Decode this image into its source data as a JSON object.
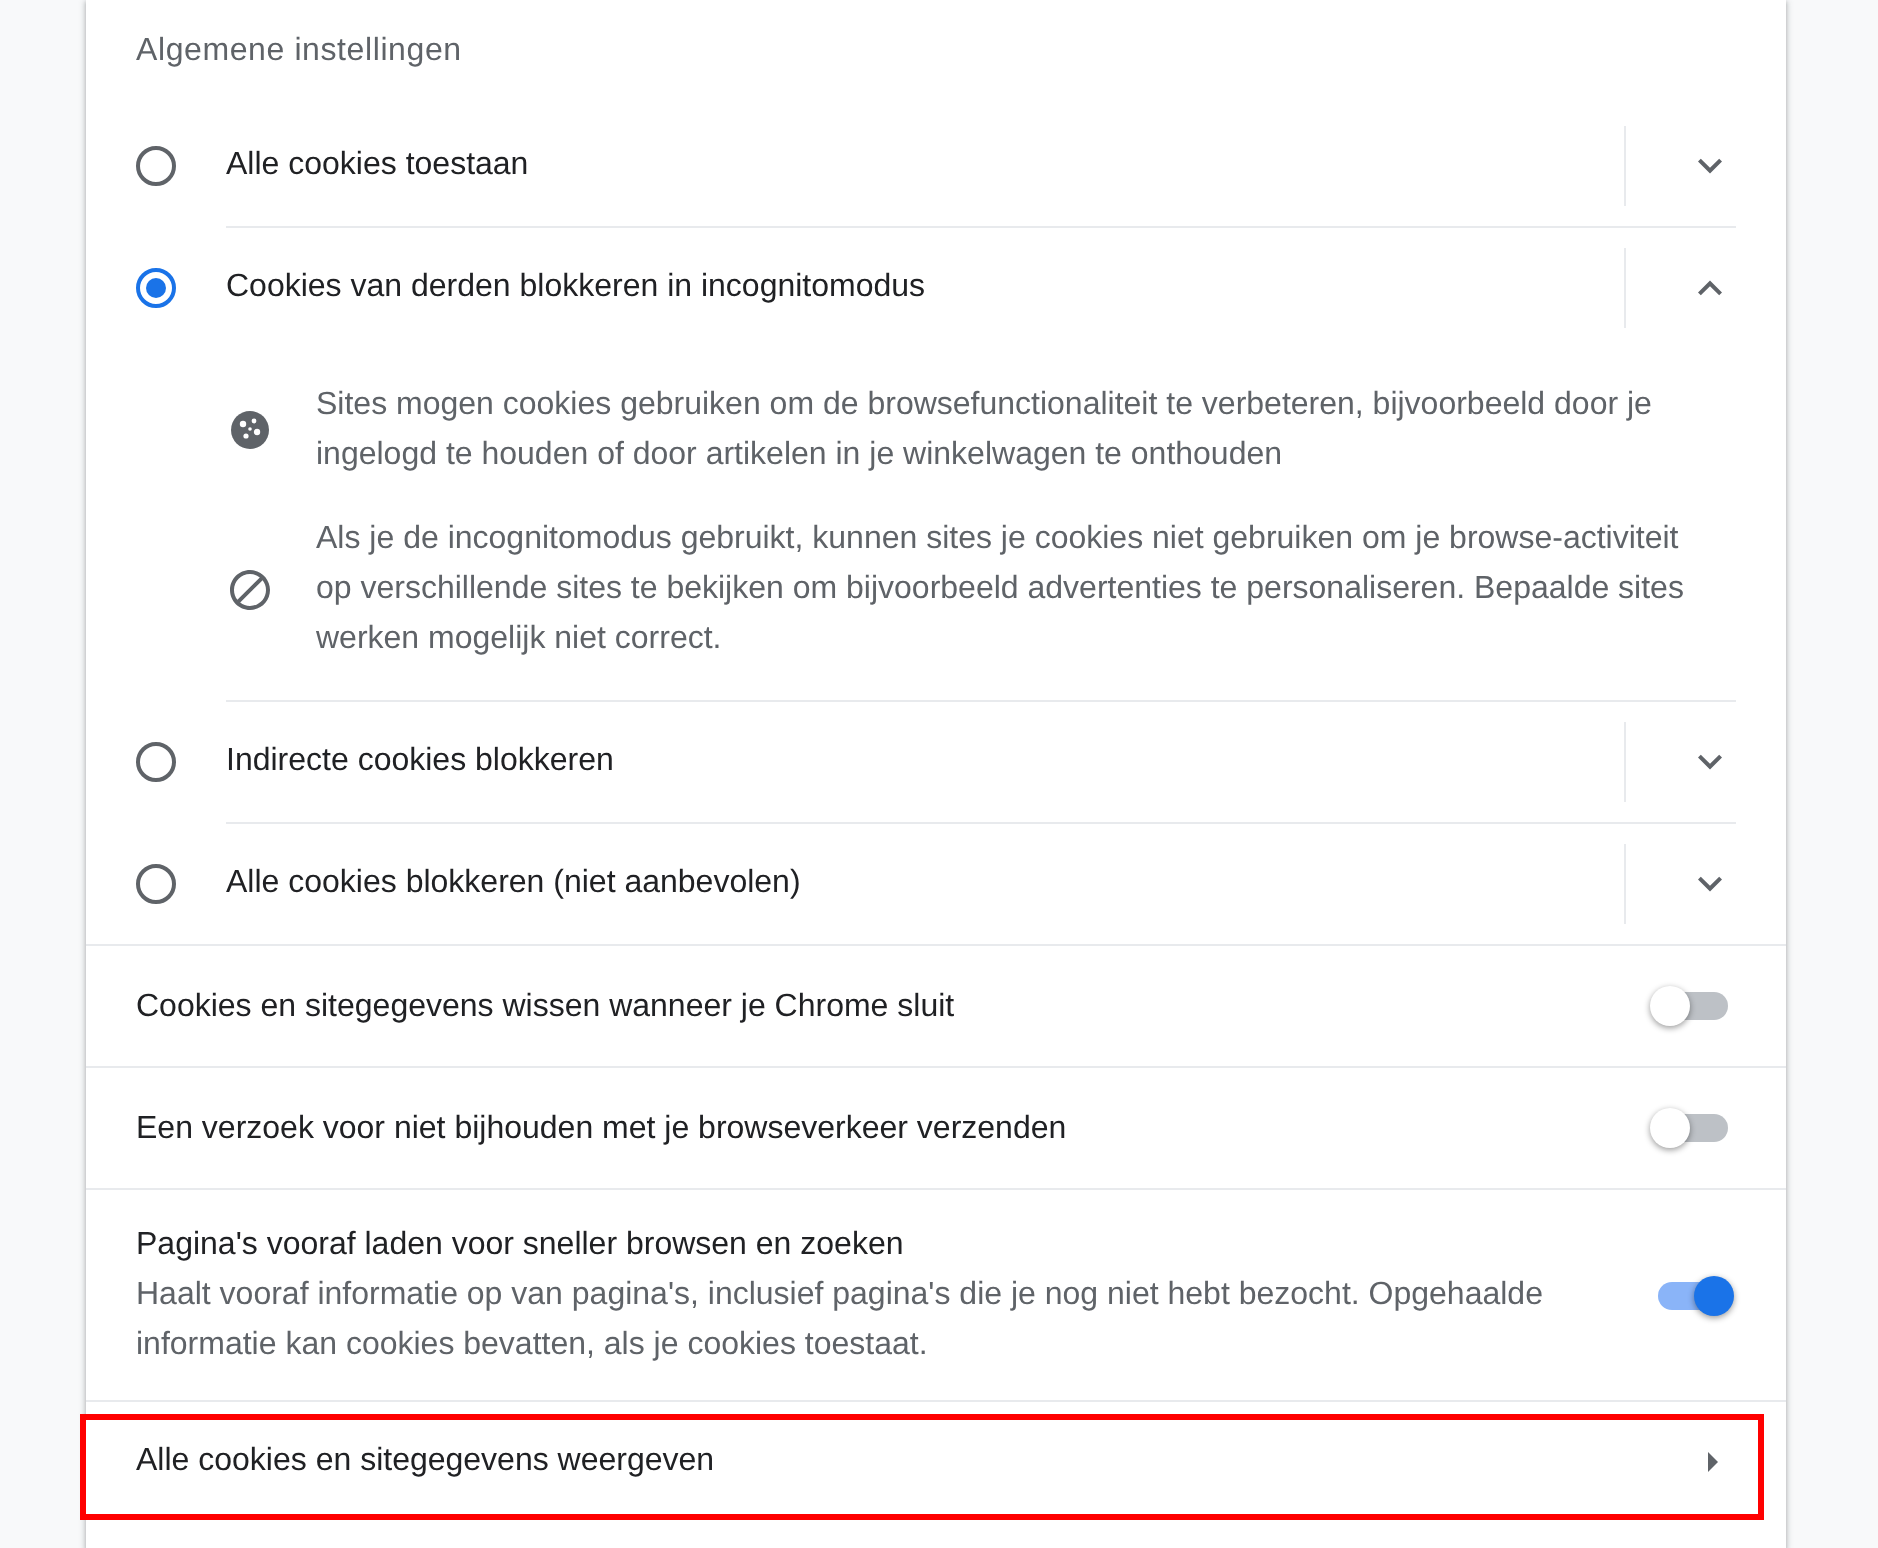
{
  "section": {
    "title": "Algemene instellingen"
  },
  "cookie_options": [
    {
      "label": "Alle cookies toestaan",
      "selected": false,
      "expanded": false
    },
    {
      "label": "Cookies van derden blokkeren in incognitomodus",
      "selected": true,
      "expanded": true,
      "details": [
        {
          "kind": "cookie",
          "text": "Sites mogen cookies gebruiken om de browsefunctionaliteit te verbeteren, bijvoorbeeld door je ingelogd te houden of door artikelen in je winkelwagen te onthouden"
        },
        {
          "kind": "blocked",
          "text": "Als je de incognitomodus gebruikt, kunnen sites je cookies niet gebruiken om je browse-activiteit op verschillende sites te bekijken om bijvoorbeeld advertenties te personaliseren. Bepaalde sites werken mogelijk niet correct."
        }
      ]
    },
    {
      "label": "Indirecte cookies blokkeren",
      "selected": false,
      "expanded": false
    },
    {
      "label": "Alle cookies blokkeren (niet aanbevolen)",
      "selected": false,
      "expanded": false
    }
  ],
  "toggles": [
    {
      "label": "Cookies en sitegegevens wissen wanneer je Chrome sluit",
      "on": false
    },
    {
      "label": "Een verzoek voor niet bijhouden met je browseverkeer verzenden",
      "on": false
    },
    {
      "label": "Pagina's vooraf laden voor sneller browsen en zoeken",
      "description": "Haalt vooraf informatie op van pagina's, inclusief pagina's die je nog niet hebt bezocht. Opgehaalde informatie kan cookies bevatten, als je cookies toestaat.",
      "on": true
    }
  ],
  "links": [
    {
      "label": "Alle cookies en sitegegevens weergeven",
      "highlighted": true
    }
  ]
}
